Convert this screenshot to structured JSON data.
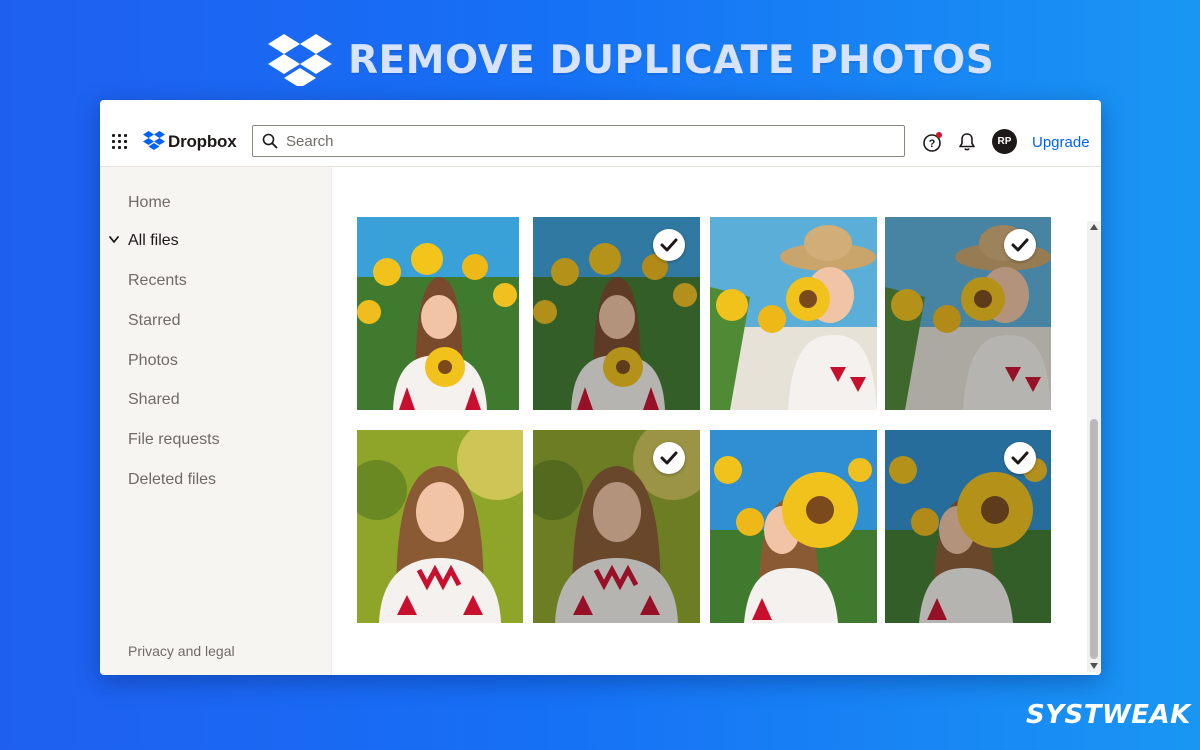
{
  "banner": {
    "title": "REMOVE DUPLICATE PHOTOS"
  },
  "topbar": {
    "brand": "Dropbox",
    "search_placeholder": "Search",
    "avatar_initials": "RP",
    "upgrade_label": "Upgrade"
  },
  "sidebar": {
    "items": [
      {
        "label": "Home"
      },
      {
        "label": "All files",
        "active": true
      },
      {
        "label": "Recents"
      },
      {
        "label": "Starred"
      },
      {
        "label": "Photos"
      },
      {
        "label": "Shared"
      },
      {
        "label": "File requests"
      },
      {
        "label": "Deleted files"
      }
    ],
    "footer": "Privacy and legal"
  },
  "photos": [
    {
      "scene": "sunflower-hold",
      "selected": false
    },
    {
      "scene": "sunflower-hold",
      "selected": true
    },
    {
      "scene": "smell-flower",
      "selected": false
    },
    {
      "scene": "smell-flower",
      "selected": true
    },
    {
      "scene": "portrait",
      "selected": false
    },
    {
      "scene": "portrait",
      "selected": true
    },
    {
      "scene": "flower-face",
      "selected": false
    },
    {
      "scene": "flower-face",
      "selected": true
    }
  ],
  "watermark": "SYSTWEAK",
  "colors": {
    "accent": "#0061fe",
    "background": "#1a6ff4",
    "sidebar": "#f7f5f2"
  }
}
